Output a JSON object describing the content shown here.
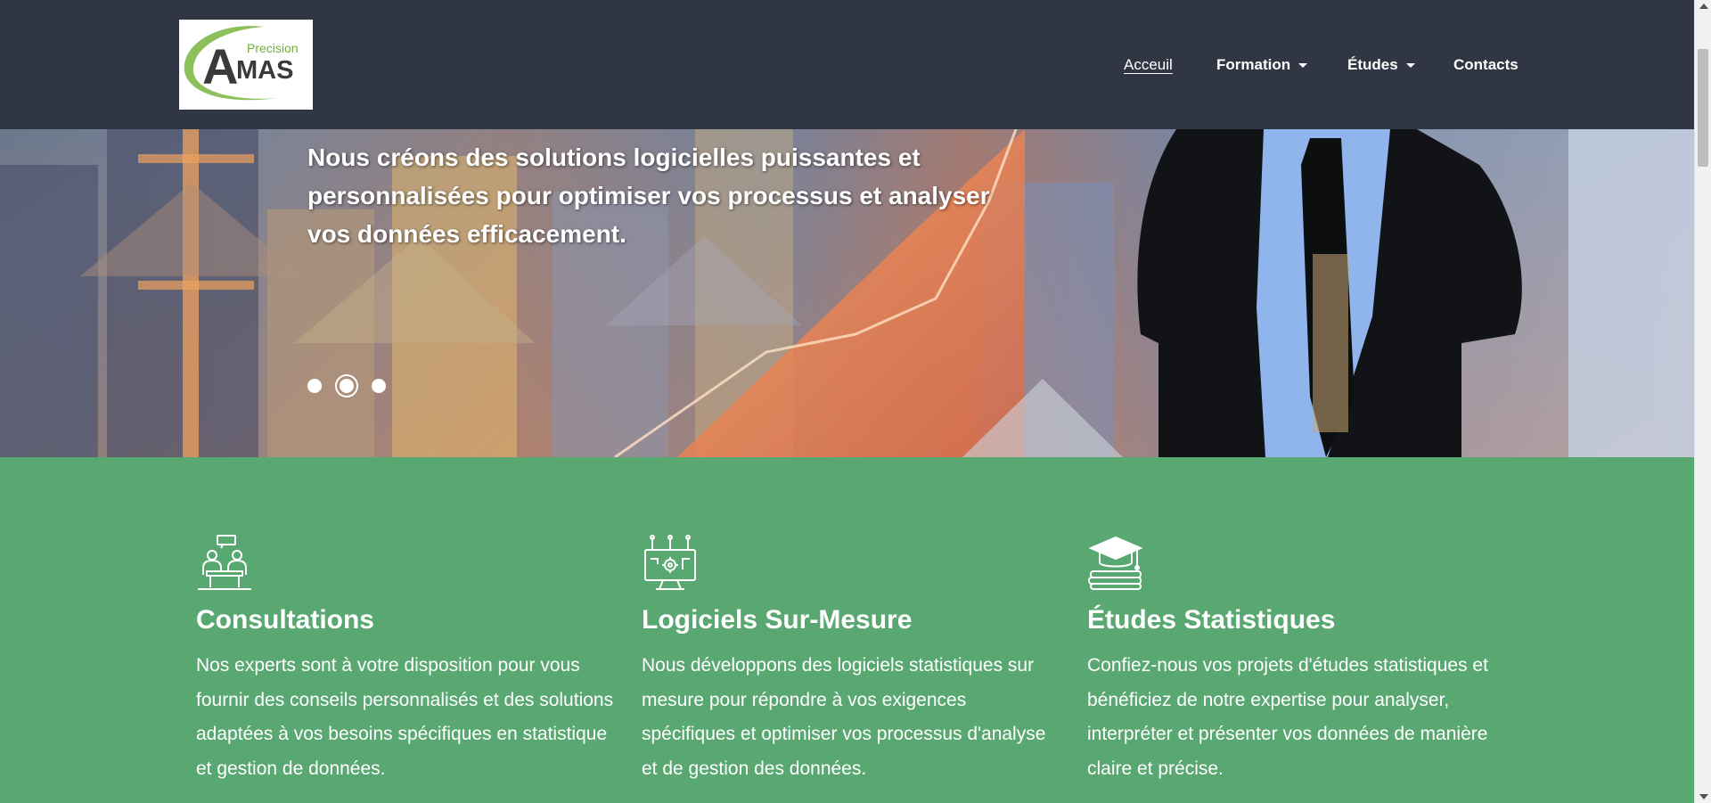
{
  "logo": {
    "word_small": "Precision",
    "word_big": "MAS",
    "letter": "A"
  },
  "nav": {
    "items": [
      {
        "label": "Acceuil",
        "active": true,
        "dropdown": false
      },
      {
        "label": "Formation",
        "active": false,
        "dropdown": true
      },
      {
        "label": "Études",
        "active": false,
        "dropdown": true
      },
      {
        "label": "Contacts",
        "active": false,
        "dropdown": false
      }
    ]
  },
  "hero": {
    "caption": "Nous créons des solutions logicielles puissantes et personnalisées pour optimiser vos processus et analyser vos données efficacement.",
    "slides": 3,
    "active_slide": 2
  },
  "features": [
    {
      "icon": "consultation-icon",
      "title": "Consultations",
      "text": "Nos experts sont à votre disposition pour vous fournir des conseils personnalisés et des solutions adaptées à vos besoins spécifiques en statistique et gestion de données."
    },
    {
      "icon": "software-icon",
      "title": "Logiciels Sur-Mesure",
      "text": "Nous développons des logiciels statistiques sur mesure pour répondre à vos exigences spécifiques et optimiser vos processus d'analyse et de gestion des données."
    },
    {
      "icon": "graduation-cap-icon",
      "title": "Études Statistiques",
      "text": "Confiez-nous vos projets d'études statistiques et bénéficiez de notre expertise pour analyser, interpréter et présenter vos données de manière claire et précise."
    }
  ],
  "colors": {
    "navbar": "#313645",
    "features_bg": "#5aa871",
    "logo_green": "#7cb342",
    "logo_dark": "#333333"
  }
}
